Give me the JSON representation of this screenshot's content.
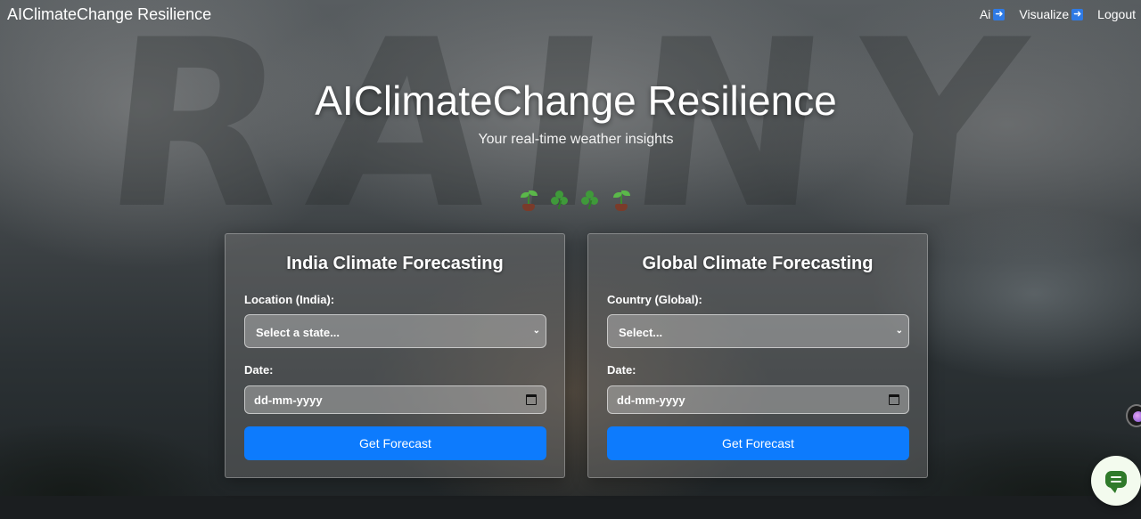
{
  "navbar": {
    "brand": "AIClimateChange Resilience",
    "links": [
      {
        "label": "Ai",
        "icon": "right-arrow-icon"
      },
      {
        "label": "Visualize",
        "icon": "right-arrow-icon"
      },
      {
        "label": "Logout"
      }
    ]
  },
  "hero": {
    "title": "AIClimateChange Resilience",
    "subtitle": "Your real-time weather insights",
    "icons": [
      "seedling-icon",
      "shamrock-icon",
      "shamrock-icon",
      "seedling-icon"
    ]
  },
  "india_card": {
    "title": "India Climate Forecasting",
    "location_label": "Location (India):",
    "location_value": "Select a state...",
    "date_label": "Date:",
    "date_placeholder": "dd-mm-yyyy",
    "button_label": "Get Forecast"
  },
  "global_card": {
    "title": "Global Climate Forecasting",
    "location_label": "Country (Global):",
    "location_value": "Select...",
    "date_label": "Date:",
    "date_placeholder": "dd-mm-yyyy",
    "button_label": "Get Forecast"
  },
  "colors": {
    "primary_button": "#0d7bfd",
    "chat_fab_bg": "#f3fbee",
    "chat_icon": "#2f7a2a"
  }
}
